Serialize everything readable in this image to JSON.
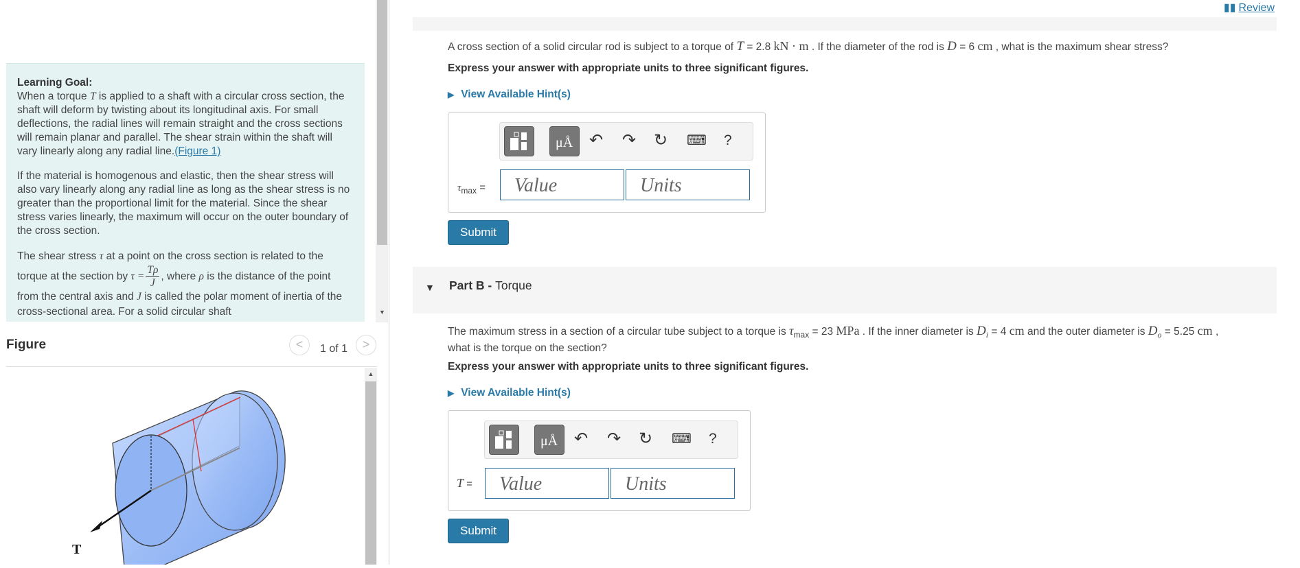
{
  "header": {
    "review_label": "Review"
  },
  "learning": {
    "title": "Learning Goal:",
    "p1_a": "When a torque ",
    "p1_T": "T",
    "p1_b": " is applied to a shaft with a circular cross section, the shaft will deform by twisting about its longitudinal axis. For small deflections, the radial lines will remain straight and the cross sections will remain planar and parallel. The shear strain within the shaft will vary linearly along any radial line.",
    "p1_link": "(Figure 1)",
    "p2": "If the material is homogenous and elastic, then the shear stress will also vary linearly along any radial line as long as the shear stress is no greater than the proportional limit for the material. Since the shear stress varies linearly, the maximum will occur on the outer boundary of the cross section.",
    "p3_a": "The shear stress ",
    "p3_tau": "τ",
    "p3_b": " at a point on the cross section is related to the torque at the section by ",
    "p3_eq_lhs": "τ =",
    "p3_frac_num": "Tρ",
    "p3_frac_den": "J",
    "p3_c": ", where ",
    "p3_rho": "ρ",
    "p3_d": " is the distance of the point from the central axis and ",
    "p3_J": "J",
    "p3_e": " is called the polar moment of inertia of the cross-sectional area. For a solid circular shaft"
  },
  "figure": {
    "title": "Figure",
    "counter": "1 of 1",
    "prev": "<",
    "next": ">",
    "torque_label": "T"
  },
  "partA": {
    "q_a": "A cross section of a solid circular rod is subject to a torque of ",
    "q_T": "T",
    "q_b": " = 2.8 ",
    "q_unit1": "kN · m",
    "q_c": " . If the diameter of the rod is ",
    "q_D": "D",
    "q_d": " = 6 ",
    "q_unit2": "cm",
    "q_e": " , what is the maximum shear stress?",
    "instruction": "Express your answer with appropriate units to three significant figures.",
    "hint": "View Available Hint(s)",
    "label_sym": "τ",
    "label_sub": "max",
    "label_eq": " =",
    "value_placeholder": "Value",
    "units_placeholder": "Units",
    "submit": "Submit"
  },
  "partB": {
    "title_bold": "Part B - ",
    "title": "Torque",
    "q_a": "The maximum stress in a section of a circular tube subject to a torque is ",
    "q_tau": "τ",
    "q_tau_sub": "max",
    "q_b": " = 23 ",
    "q_unit1": "MPa",
    "q_c": " . If the inner diameter is ",
    "q_Di": "D",
    "q_Di_sub": "i",
    "q_d": " = 4 ",
    "q_unit2": "cm",
    "q_e": " and the outer diameter is ",
    "q_Do": "D",
    "q_Do_sub": "o",
    "q_f": " = 5.25 ",
    "q_unit3": "cm",
    "q_g": " ,",
    "q_line2": "what is the torque on the section?",
    "instruction": "Express your answer with appropriate units to three significant figures.",
    "hint": "View Available Hint(s)",
    "label_sym": "T",
    "label_eq": " =",
    "value_placeholder": "Value",
    "units_placeholder": "Units",
    "submit": "Submit"
  },
  "toolbar": {
    "units_btn": "μÅ",
    "help": "?"
  }
}
